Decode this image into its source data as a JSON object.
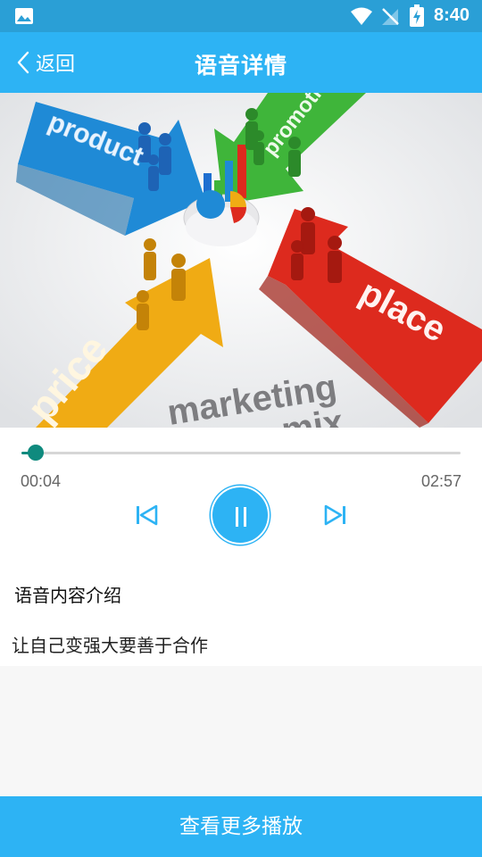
{
  "status_bar": {
    "time": "8:40",
    "icons": [
      "image-icon",
      "wifi-icon",
      "no-signal-icon",
      "battery-charging-icon"
    ]
  },
  "nav": {
    "back_label": "返回",
    "title": "语音详情"
  },
  "cover": {
    "words": [
      "product",
      "promotion",
      "place",
      "price",
      "marketing",
      "mix"
    ]
  },
  "player": {
    "current_time": "00:04",
    "total_time": "02:57",
    "progress_fraction": 0.023,
    "state": "playing"
  },
  "intro": {
    "heading": "语音内容介绍",
    "text": "让自己变强大要善于合作"
  },
  "bottom_button": {
    "label": "查看更多播放"
  },
  "colors": {
    "status_bar": "#2a9fd6",
    "header": "#2db3f4",
    "progress": "#0f8a7e",
    "background": "#f7f7f7"
  }
}
